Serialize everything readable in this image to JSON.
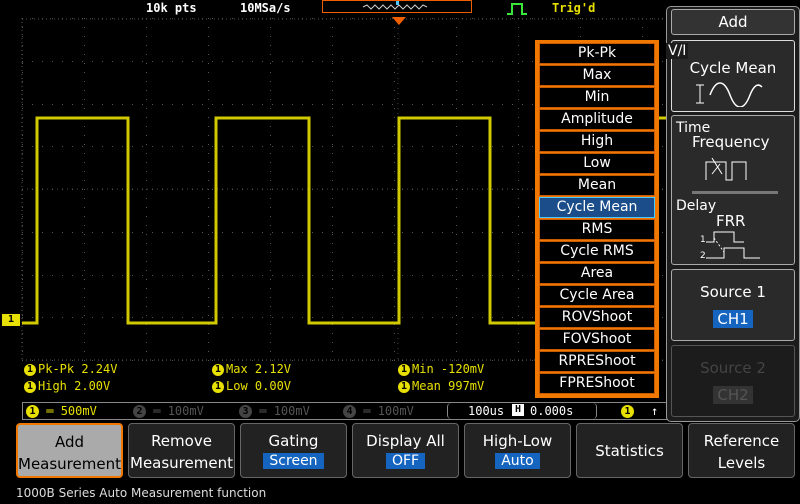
{
  "top_bar": {
    "record_length": "10k pts",
    "sample_rate": "10MSa/s",
    "trigger_status": "Trig'd"
  },
  "channel_marker": "1",
  "measurement_menu": {
    "items": [
      "Pk-Pk",
      "Max",
      "Min",
      "Amplitude",
      "High",
      "Low",
      "Mean",
      "Cycle Mean",
      "RMS",
      "Cycle RMS",
      "Area",
      "Cycle Area",
      "ROVShoot",
      "FOVShoot",
      "RPREShoot",
      "FPREShoot"
    ],
    "selected": "Cycle Mean"
  },
  "readouts": {
    "pkpk": "Pk-Pk 2.24V",
    "max": "Max 2.12V",
    "min": "Min -120mV",
    "high": "High 2.00V",
    "low": "Low 0.00V",
    "mean": "Mean 997mV",
    "ch_label": "1"
  },
  "status_bar": {
    "ch1": {
      "num": "1",
      "scale": "500mV"
    },
    "ch2": {
      "num": "2",
      "scale": "100mV"
    },
    "ch3": {
      "num": "3",
      "scale": "100mV"
    },
    "ch4": {
      "num": "4",
      "scale": "100mV"
    },
    "timebase": "100us",
    "hpos_icon": "H",
    "hpos": "0.000s",
    "trig_ch": "1"
  },
  "right_panel": {
    "title": "Add",
    "vi": {
      "category": "V/I",
      "label": "Cycle Mean"
    },
    "time": {
      "category": "Time",
      "label": "Frequency"
    },
    "delay": {
      "category": "Delay",
      "label": "FRR"
    },
    "source1": {
      "label": "Source 1",
      "value": "CH1"
    },
    "source2": {
      "label": "Source 2",
      "value": "CH2"
    }
  },
  "bottom_buttons": [
    {
      "l1": "Add",
      "l2": "Measurement"
    },
    {
      "l1": "Remove",
      "l2": "Measurement"
    },
    {
      "l1": "Gating",
      "val": "Screen"
    },
    {
      "l1": "Display All",
      "val": "OFF"
    },
    {
      "l1": "High-Low",
      "val": "Auto"
    },
    {
      "l1": "Statistics"
    },
    {
      "l1": "Reference",
      "l2": "Levels"
    }
  ],
  "caption": "1000B Series Auto Measurement function",
  "colors": {
    "ch1": "#e8e000",
    "menu_border": "#f07800",
    "selected": "#1a4d8a",
    "value_bg": "#1565c0"
  }
}
